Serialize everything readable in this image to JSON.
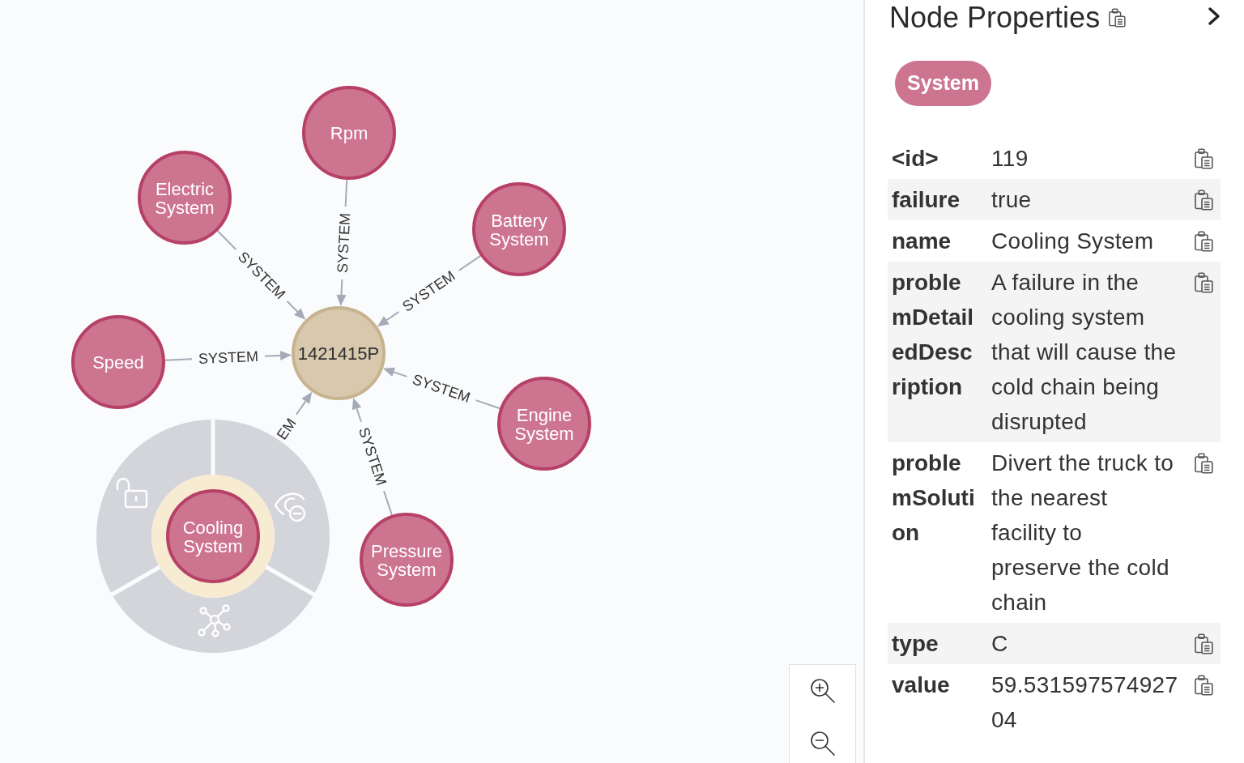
{
  "graph": {
    "center": {
      "label": "1421415P",
      "color": "#d8c9ae",
      "selected": false
    },
    "neighbors": [
      {
        "label": "Rpm",
        "color": "#cc7490",
        "selected": false,
        "edge_label": "SYSTEM"
      },
      {
        "label": "Electric System",
        "color": "#cc7490",
        "selected": false,
        "edge_label": "SYSTEM"
      },
      {
        "label": "Battery System",
        "color": "#cc7490",
        "selected": false,
        "edge_label": "SYSTEM"
      },
      {
        "label": "Speed",
        "color": "#cc7490",
        "selected": false,
        "edge_label": "SYSTEM"
      },
      {
        "label": "Engine System",
        "color": "#cc7490",
        "selected": false,
        "edge_label": "SYSTEM"
      },
      {
        "label": "Cooling System",
        "color": "#cc7490",
        "selected": true,
        "edge_label": "EM"
      },
      {
        "label": "Pressure System",
        "color": "#cc7490",
        "selected": false,
        "edge_label": "SYSTEM"
      }
    ]
  },
  "properties_panel": {
    "title": "Node Properties",
    "labels": [
      "System"
    ],
    "properties": [
      {
        "key": "<id>",
        "value": "119"
      },
      {
        "key": "failure",
        "value": "true"
      },
      {
        "key": "name",
        "value": "Cooling System"
      },
      {
        "key": "problemDetailedDescription",
        "value": "A failure in the cooling system that will cause the cold chain being disrupted"
      },
      {
        "key": "problemSolution",
        "value": "Divert the truck to the nearest facility to preserve the cold chain"
      },
      {
        "key": "type",
        "value": "C"
      },
      {
        "key": "value",
        "value": "59.53159757492704"
      }
    ]
  }
}
